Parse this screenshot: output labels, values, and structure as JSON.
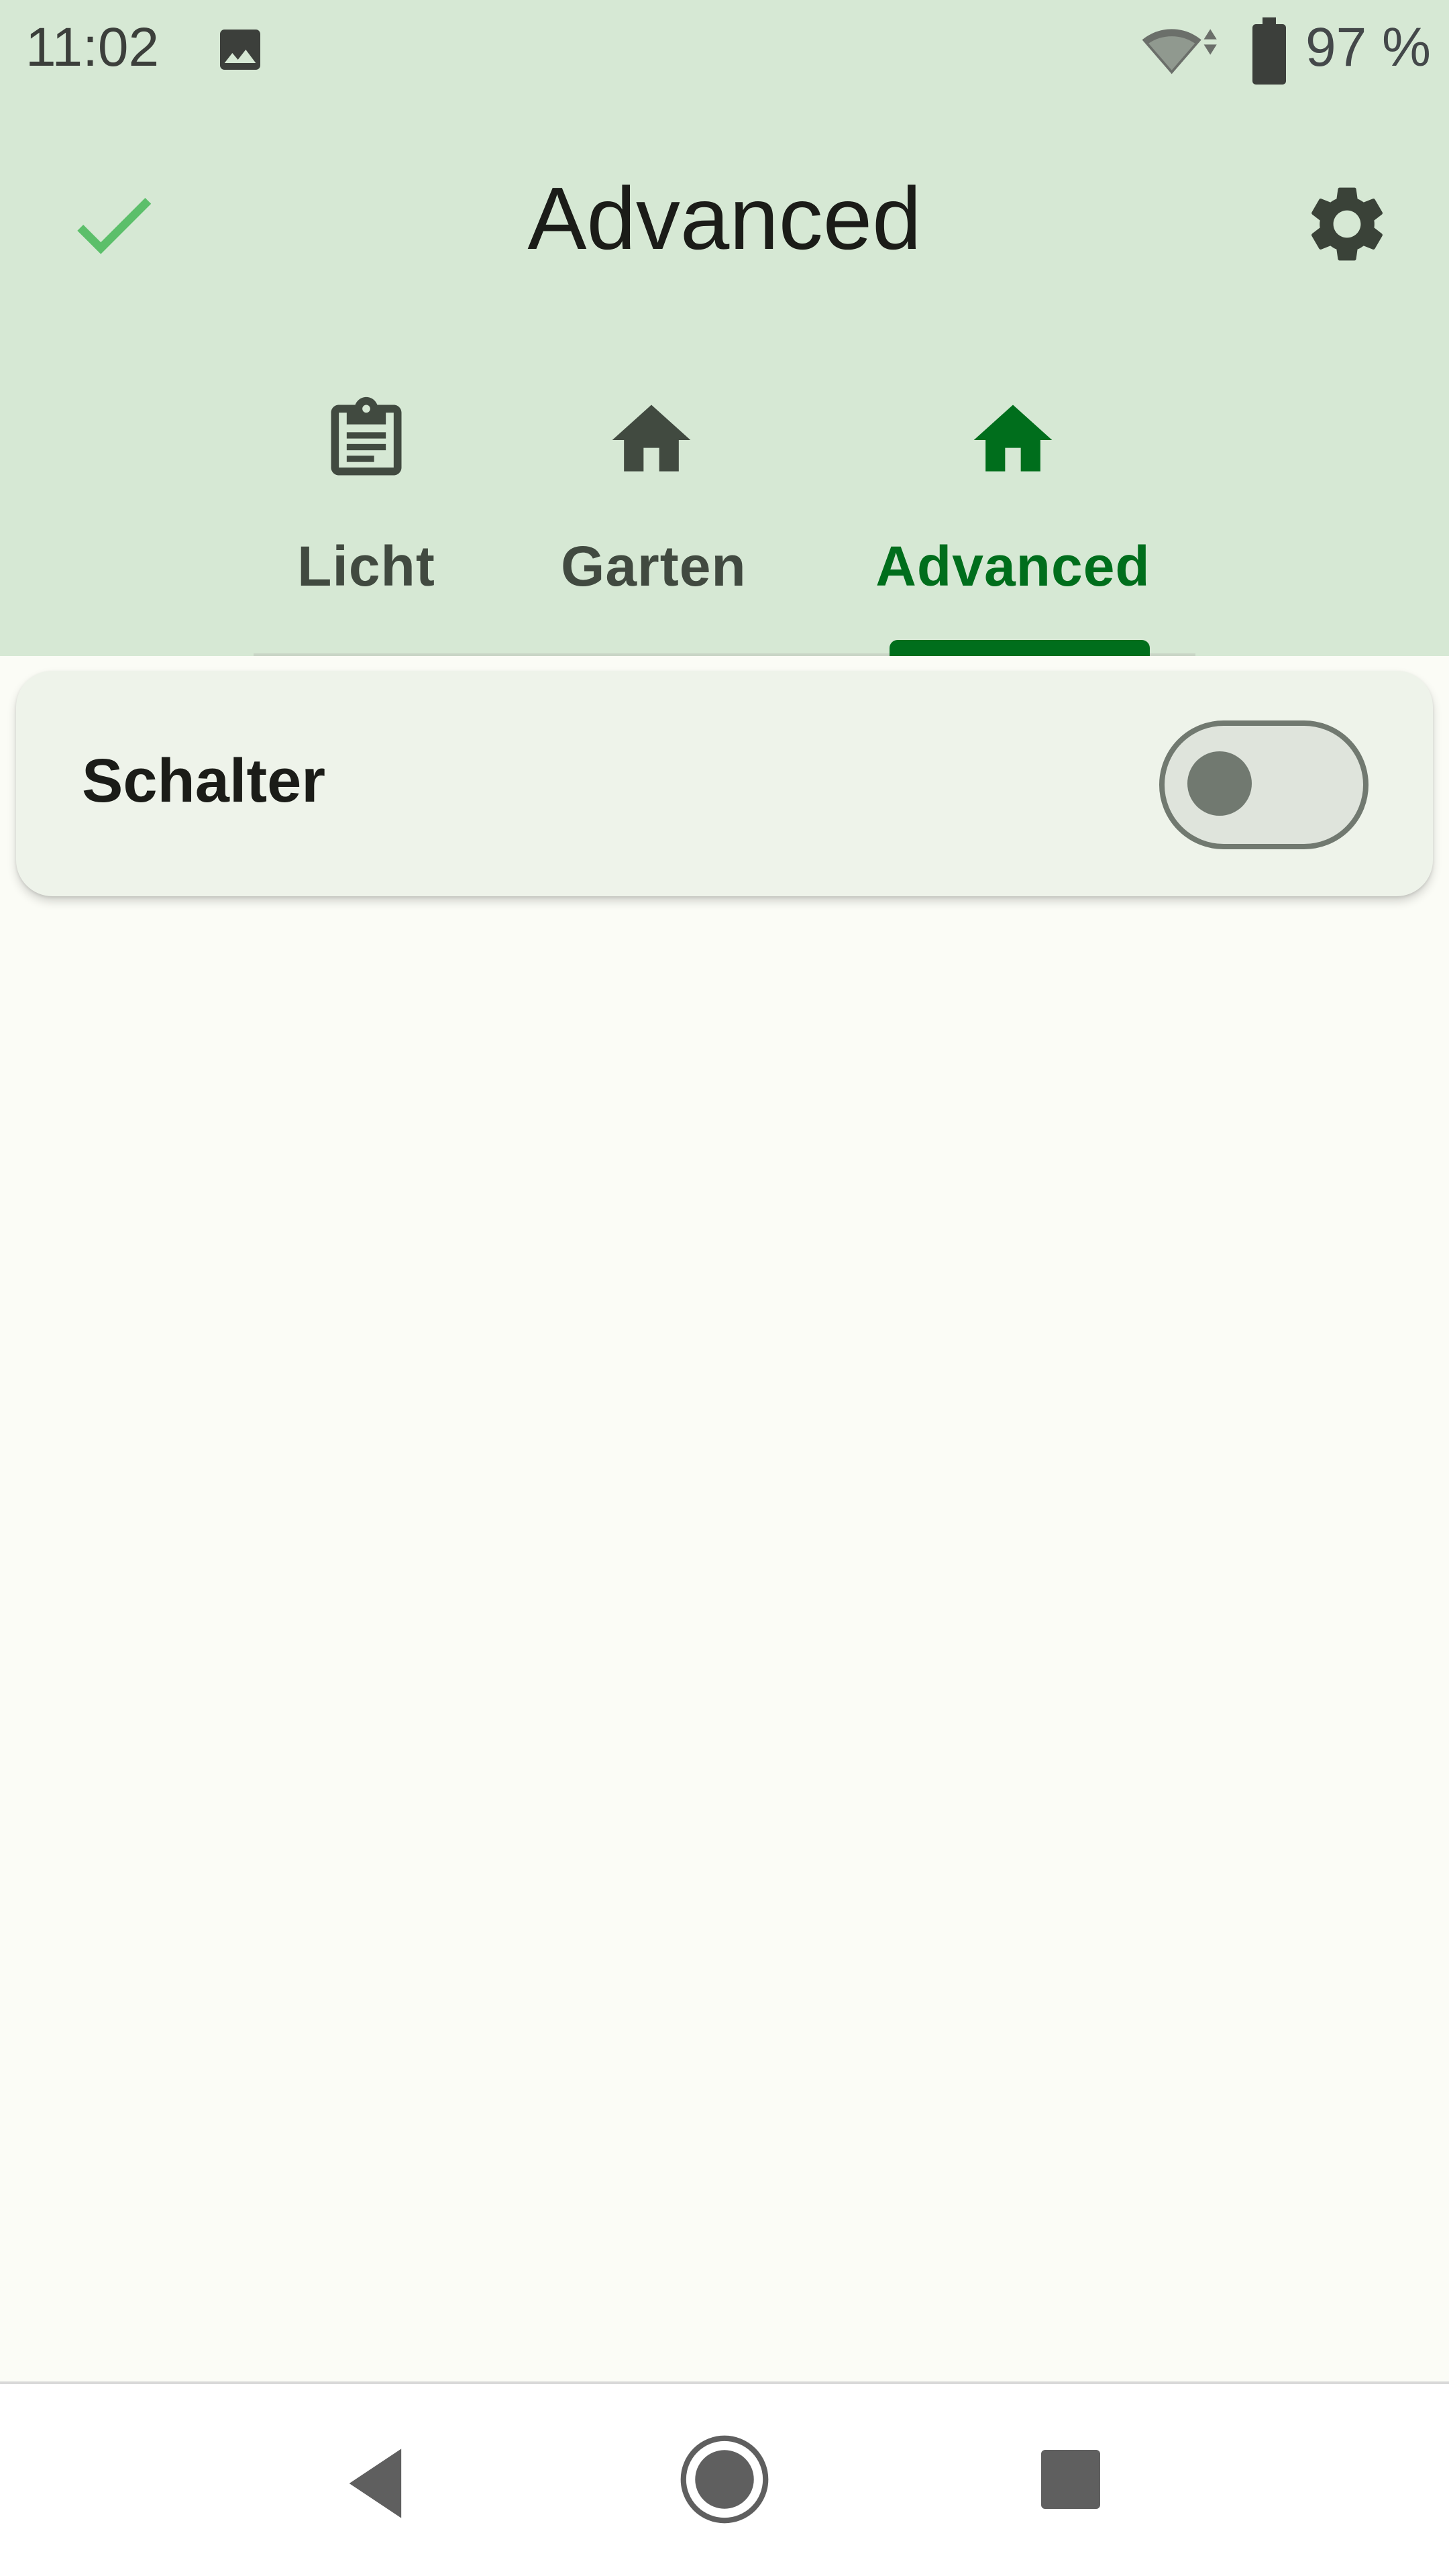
{
  "status_bar": {
    "time": "11:02",
    "battery": "97 %",
    "icons": [
      "gallery-icon",
      "wifi-icon",
      "battery-icon"
    ]
  },
  "app_bar": {
    "title": "Advanced",
    "left_action_icon": "check-icon",
    "right_action_icon": "gear-icon"
  },
  "tabs": [
    {
      "label": "Licht",
      "icon": "clipboard-icon",
      "active": false
    },
    {
      "label": "Garten",
      "icon": "home-icon",
      "active": false
    },
    {
      "label": "Advanced",
      "icon": "home-icon",
      "active": true
    }
  ],
  "card": {
    "label": "Schalter",
    "switch_on": false
  },
  "navigation_bar": {
    "icons": [
      "back-icon",
      "home-circle-icon",
      "recents-icon"
    ]
  },
  "colors": {
    "header_bg": "#d6e8d4",
    "accent": "#006e1c",
    "check": "#5cbf6a",
    "page_bg": "#fbfcf6",
    "card_bg": "#eef3ea"
  }
}
